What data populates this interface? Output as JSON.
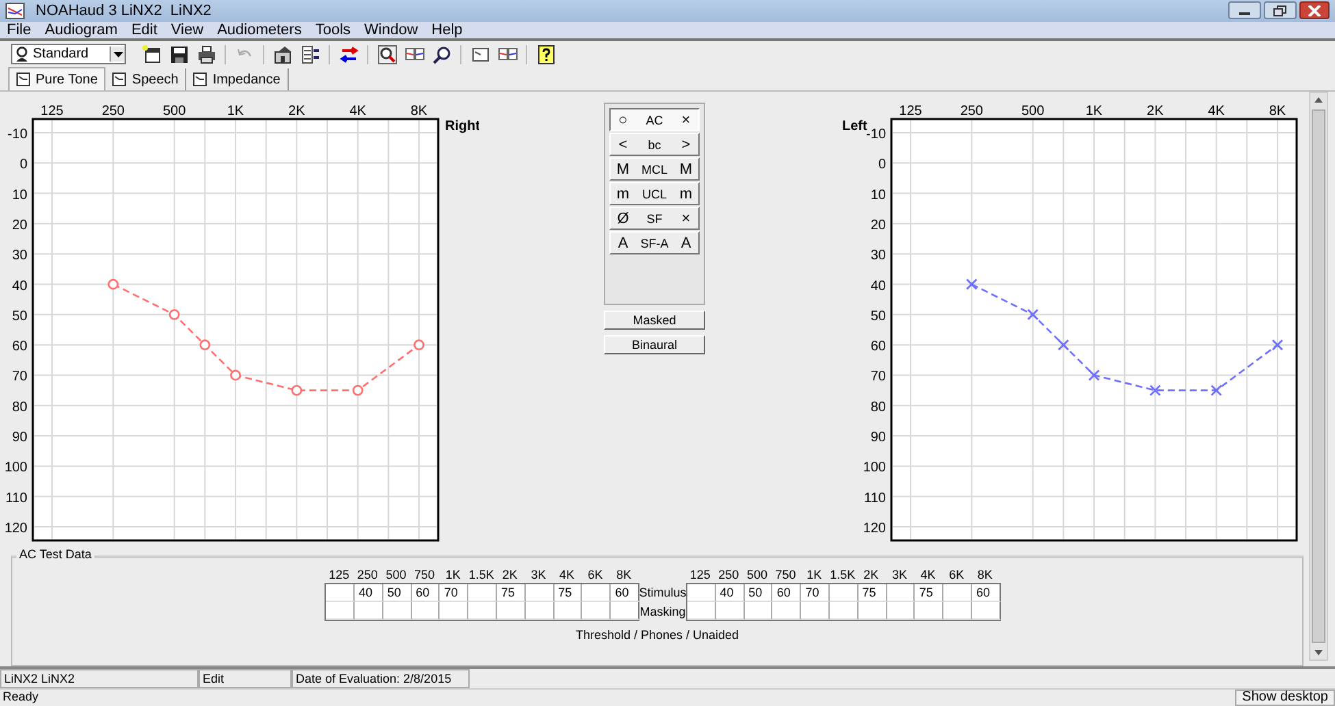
{
  "window": {
    "title": "NOAHaud 3 LiNX2  LiNX2"
  },
  "menu": [
    "File",
    "Audiogram",
    "Edit",
    "View",
    "Audiometers",
    "Tools",
    "Window",
    "Help"
  ],
  "toolbar": {
    "profile": "Standard"
  },
  "tabs": [
    {
      "label": "Pure Tone",
      "selected": true
    },
    {
      "label": "Speech",
      "selected": false
    },
    {
      "label": "Impedance",
      "selected": false
    }
  ],
  "audiograms": [
    {
      "side_label": "Right",
      "chart_data": {
        "type": "line",
        "grid": true,
        "categories": [
          "125",
          null,
          "250",
          null,
          "500",
          null,
          "1K",
          null,
          "2K",
          null,
          "4K",
          null,
          "8K"
        ],
        "yticks": [
          -10,
          0,
          10,
          20,
          30,
          40,
          50,
          60,
          70,
          80,
          90,
          100,
          110,
          120
        ],
        "ylim": [
          120,
          -10
        ],
        "series": [
          {
            "color": "#ff6f6f",
            "marker": "circle",
            "line_style": "dashed",
            "values": [
              null,
              null,
              40,
              null,
              50,
              60,
              70,
              null,
              75,
              null,
              75,
              null,
              60
            ]
          }
        ]
      }
    },
    {
      "side_label": "Left",
      "chart_data": {
        "type": "line",
        "grid": true,
        "categories": [
          "125",
          null,
          "250",
          null,
          "500",
          null,
          "1K",
          null,
          "2K",
          null,
          "4K",
          null,
          "8K"
        ],
        "yticks": [
          -10,
          0,
          10,
          20,
          30,
          40,
          50,
          60,
          70,
          80,
          90,
          100,
          110,
          120
        ],
        "ylim": [
          120,
          -10
        ],
        "series": [
          {
            "color": "#6f6fff",
            "marker": "cross",
            "line_style": "dashed",
            "values": [
              null,
              null,
              40,
              null,
              50,
              60,
              70,
              null,
              75,
              null,
              75,
              null,
              60
            ]
          }
        ]
      }
    }
  ],
  "symbol_legend": [
    {
      "left_symbol": "○",
      "label": "AC",
      "right_symbol": "×",
      "selected": true
    },
    {
      "left_symbol": "<",
      "label": "bc",
      "right_symbol": ">",
      "selected": false
    },
    {
      "left_symbol": "M",
      "label": "MCL",
      "right_symbol": "M",
      "selected": false
    },
    {
      "left_symbol": "m",
      "label": "UCL",
      "right_symbol": "m",
      "selected": false
    },
    {
      "left_symbol": "Ø",
      "label": "SF",
      "right_symbol": "×",
      "selected": false
    },
    {
      "left_symbol": "A",
      "label": "SF-A",
      "right_symbol": "A",
      "selected": false
    }
  ],
  "buttons": [
    "Masked",
    "Binaural"
  ],
  "ac_test_data": {
    "title": "AC Test Data",
    "row_labels": [
      "Stimulus",
      "Masking"
    ],
    "tables": [
      {
        "columns": [
          {
            "frequency": "125"
          },
          {
            "frequency": "250",
            "stimulus": "40"
          },
          {
            "frequency": "500",
            "stimulus": "50"
          },
          {
            "frequency": "750",
            "stimulus": "60"
          },
          {
            "frequency": "1K",
            "stimulus": "70"
          },
          {
            "frequency": "1.5K"
          },
          {
            "frequency": "2K",
            "stimulus": "75"
          },
          {
            "frequency": "3K"
          },
          {
            "frequency": "4K",
            "stimulus": "75"
          },
          {
            "frequency": "6K"
          },
          {
            "frequency": "8K",
            "stimulus": "60"
          }
        ]
      },
      {
        "columns": [
          {
            "frequency": "125"
          },
          {
            "frequency": "250",
            "stimulus": "40"
          },
          {
            "frequency": "500",
            "stimulus": "50"
          },
          {
            "frequency": "750",
            "stimulus": "60"
          },
          {
            "frequency": "1K",
            "stimulus": "70"
          },
          {
            "frequency": "1.5K"
          },
          {
            "frequency": "2K",
            "stimulus": "75"
          },
          {
            "frequency": "3K"
          },
          {
            "frequency": "4K",
            "stimulus": "75"
          },
          {
            "frequency": "6K"
          },
          {
            "frequency": "8K",
            "stimulus": "60"
          }
        ]
      }
    ],
    "caption": "Threshold / Phones / Unaided"
  },
  "status_bar": [
    "LiNX2 LiNX2",
    "Edit",
    "Date of Evaluation: 2/8/2015"
  ],
  "ready": "Ready",
  "show_desktop": "Show desktop"
}
